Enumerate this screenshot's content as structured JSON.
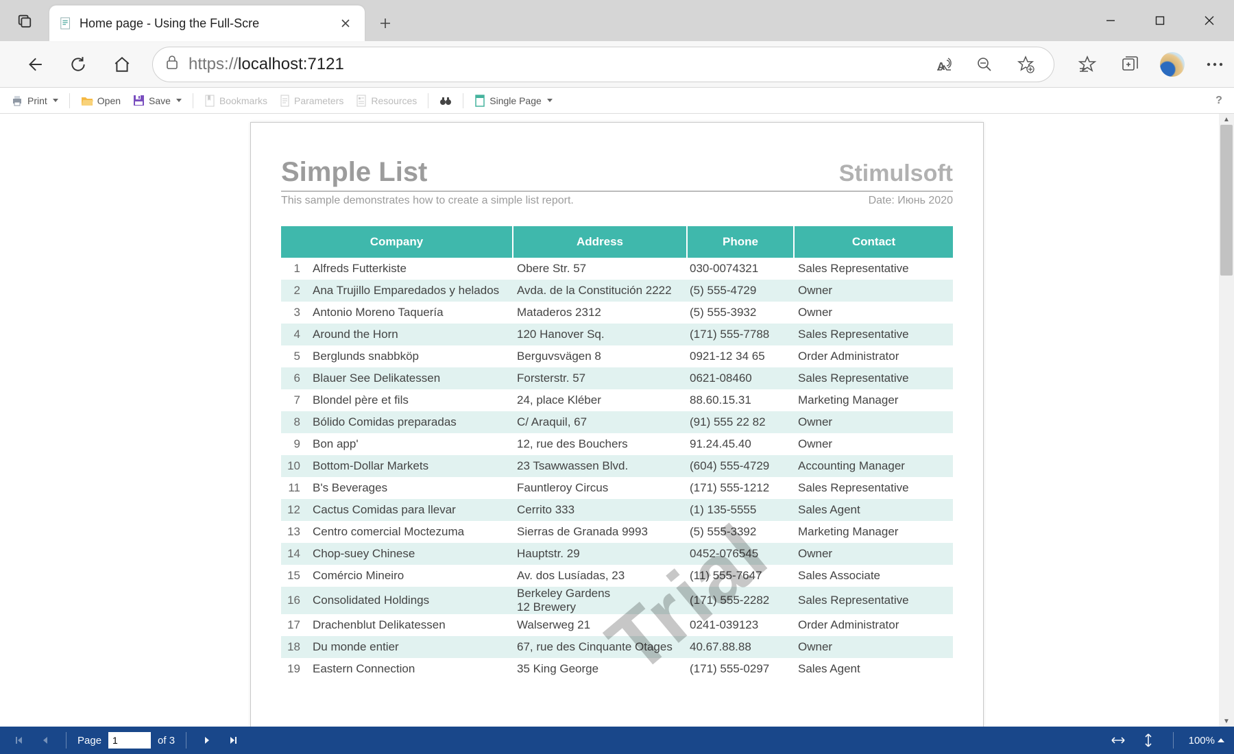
{
  "browser": {
    "tab_title": "Home page - Using the Full-Scre",
    "url_scheme": "https://",
    "url_host": "localhost:",
    "url_port": "7121"
  },
  "viewer_toolbar": {
    "print": "Print",
    "open": "Open",
    "save": "Save",
    "bookmarks": "Bookmarks",
    "parameters": "Parameters",
    "resources": "Resources",
    "view_mode": "Single Page",
    "help": "?"
  },
  "report": {
    "title": "Simple List",
    "brand": "Stimulsoft",
    "description": "This sample demonstrates how to create a simple list report.",
    "date_label": "Date: Июнь 2020",
    "watermark": "Trial",
    "columns": {
      "company": "Company",
      "address": "Address",
      "phone": "Phone",
      "contact": "Contact"
    },
    "rows": [
      {
        "n": "1",
        "company": "Alfreds Futterkiste",
        "address": "Obere Str. 57",
        "phone": "030-0074321",
        "contact": "Sales Representative"
      },
      {
        "n": "2",
        "company": "Ana Trujillo Emparedados y helados",
        "address": "Avda. de la Constitución 2222",
        "phone": "(5) 555-4729",
        "contact": "Owner"
      },
      {
        "n": "3",
        "company": "Antonio Moreno Taquería",
        "address": "Mataderos 2312",
        "phone": "(5) 555-3932",
        "contact": "Owner"
      },
      {
        "n": "4",
        "company": "Around the Horn",
        "address": "120 Hanover Sq.",
        "phone": "(171) 555-7788",
        "contact": "Sales Representative"
      },
      {
        "n": "5",
        "company": "Berglunds snabbköp",
        "address": "Berguvsvägen 8",
        "phone": "0921-12 34 65",
        "contact": "Order Administrator"
      },
      {
        "n": "6",
        "company": "Blauer See Delikatessen",
        "address": "Forsterstr. 57",
        "phone": "0621-08460",
        "contact": "Sales Representative"
      },
      {
        "n": "7",
        "company": "Blondel père et fils",
        "address": "24, place Kléber",
        "phone": "88.60.15.31",
        "contact": "Marketing Manager"
      },
      {
        "n": "8",
        "company": "Bólido Comidas preparadas",
        "address": "C/ Araquil, 67",
        "phone": "(91) 555 22 82",
        "contact": "Owner"
      },
      {
        "n": "9",
        "company": "Bon app'",
        "address": "12, rue des Bouchers",
        "phone": "91.24.45.40",
        "contact": "Owner"
      },
      {
        "n": "10",
        "company": "Bottom-Dollar Markets",
        "address": "23 Tsawwassen Blvd.",
        "phone": "(604) 555-4729",
        "contact": "Accounting Manager"
      },
      {
        "n": "11",
        "company": "B's Beverages",
        "address": "Fauntleroy Circus",
        "phone": "(171) 555-1212",
        "contact": "Sales Representative"
      },
      {
        "n": "12",
        "company": "Cactus Comidas para llevar",
        "address": "Cerrito 333",
        "phone": "(1) 135-5555",
        "contact": "Sales Agent"
      },
      {
        "n": "13",
        "company": "Centro comercial Moctezuma",
        "address": "Sierras de Granada 9993",
        "phone": "(5) 555-3392",
        "contact": "Marketing Manager"
      },
      {
        "n": "14",
        "company": "Chop-suey Chinese",
        "address": "Hauptstr. 29",
        "phone": "0452-076545",
        "contact": "Owner"
      },
      {
        "n": "15",
        "company": "Comércio Mineiro",
        "address": "Av. dos Lusíadas, 23",
        "phone": "(11) 555-7647",
        "contact": "Sales Associate"
      },
      {
        "n": "16",
        "company": "Consolidated Holdings",
        "address": "Berkeley Gardens\n12 Brewery",
        "phone": "(171) 555-2282",
        "contact": "Sales Representative"
      },
      {
        "n": "17",
        "company": "Drachenblut Delikatessen",
        "address": "Walserweg 21",
        "phone": "0241-039123",
        "contact": "Order Administrator"
      },
      {
        "n": "18",
        "company": "Du monde entier",
        "address": "67, rue des Cinquante Otages",
        "phone": "40.67.88.88",
        "contact": "Owner"
      },
      {
        "n": "19",
        "company": "Eastern Connection",
        "address": "35 King George",
        "phone": "(171) 555-0297",
        "contact": "Sales Agent"
      }
    ]
  },
  "footer": {
    "page_label": "Page",
    "page_current": "1",
    "page_total": "of 3",
    "zoom": "100%"
  }
}
